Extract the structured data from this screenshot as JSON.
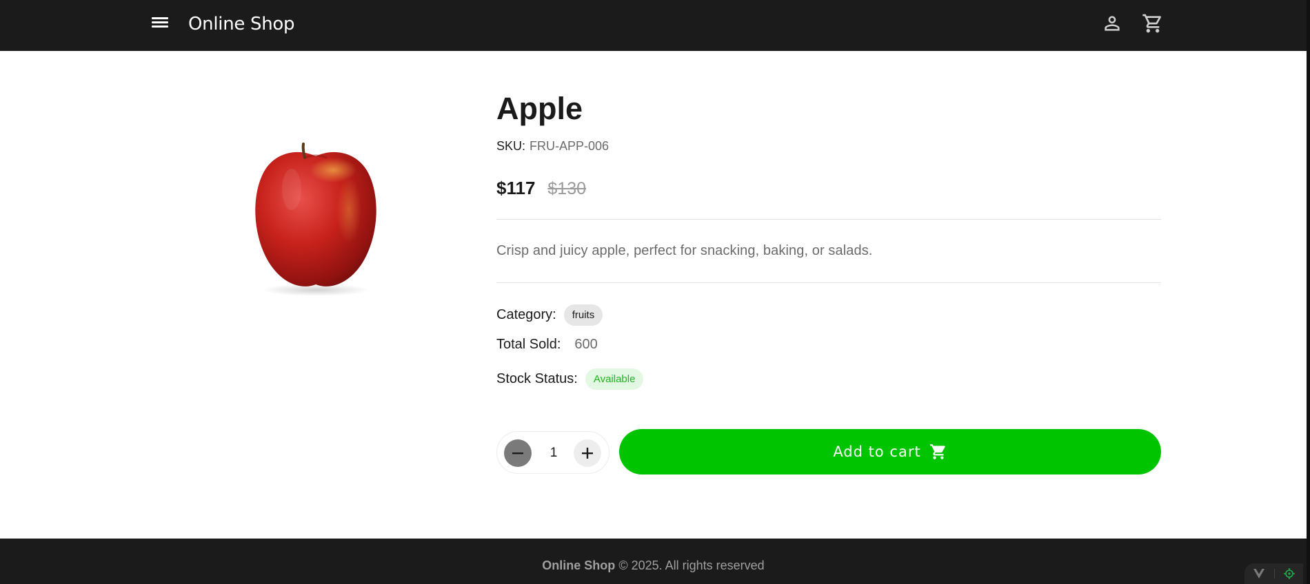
{
  "header": {
    "brand": "Online Shop",
    "icons": {
      "menu": "menu-icon",
      "user": "person-icon",
      "cart": "cart-icon"
    }
  },
  "product": {
    "image_alt": "Apple",
    "title": "Apple",
    "sku_label": "SKU:",
    "sku": "FRU-APP-006",
    "price": "$117",
    "old_price": "$130",
    "description": "Crisp and juicy apple, perfect for snacking, baking, or salads.",
    "category_label": "Category:",
    "category": "fruits",
    "total_sold_label": "Total Sold:",
    "total_sold": "600",
    "stock_label": "Stock Status:",
    "stock_status": "Available",
    "quantity": "1",
    "add_to_cart_label": "Add to cart"
  },
  "footer": {
    "brand": "Online Shop",
    "copyright": "© 2025. All rights reserved"
  },
  "colors": {
    "header_bg": "#1b1b1b",
    "accent_green": "#00c400",
    "stock_chip_text": "#1fb51f",
    "stock_chip_bg": "#e3f8e3"
  }
}
